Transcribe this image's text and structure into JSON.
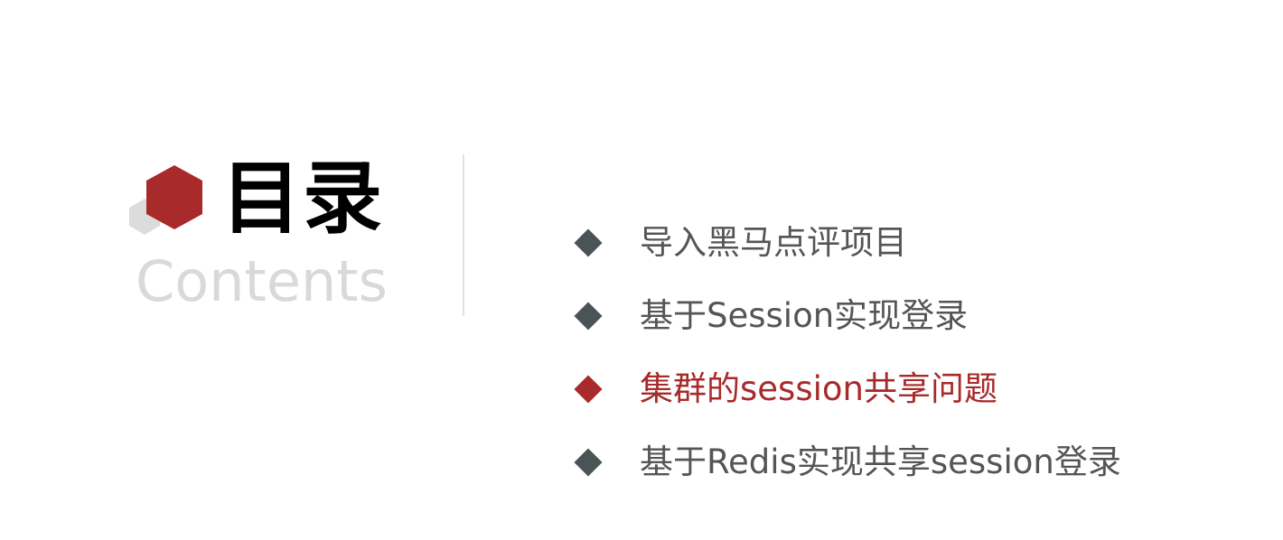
{
  "title": {
    "main": "目录",
    "sub": "Contents"
  },
  "toc": {
    "items": [
      {
        "label": "导入黑马点评项目",
        "active": false
      },
      {
        "label": "基于Session实现登录",
        "active": false
      },
      {
        "label": "集群的session共享问题",
        "active": true
      },
      {
        "label": "基于Redis实现共享session登录",
        "active": false
      }
    ]
  },
  "colors": {
    "accent": "#a82a2a",
    "logo_gray": "#dcdcdc",
    "text_default": "#555555",
    "bullet_default": "#4a5457",
    "title": "#000000",
    "subtitle": "#d9d9d9"
  },
  "icons": {
    "logo": "hexagon-cluster-icon",
    "bullet": "diamond-bullet-icon"
  }
}
